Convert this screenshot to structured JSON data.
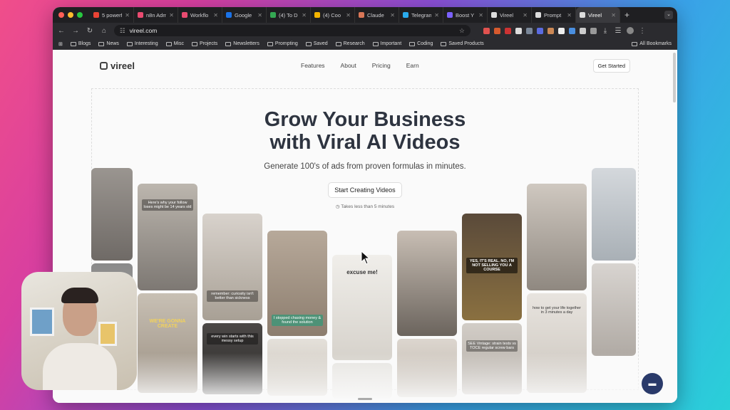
{
  "browser": {
    "tabs": [
      {
        "label": "5 powerf",
        "color": "#ea4335"
      },
      {
        "label": "n8n Adm",
        "color": "#ea4b71"
      },
      {
        "label": "Workflo",
        "color": "#ea4b71"
      },
      {
        "label": "Google",
        "color": "#1a73e8"
      },
      {
        "label": "(4) To D",
        "color": "#34a853"
      },
      {
        "label": "(4) Coo",
        "color": "#f4b400"
      },
      {
        "label": "Claude",
        "color": "#d97757"
      },
      {
        "label": "Telegram",
        "color": "#2aabee"
      },
      {
        "label": "Boost Y",
        "color": "#7b61ff"
      },
      {
        "label": "Vireel",
        "color": "#dddddd"
      },
      {
        "label": "Prompt",
        "color": "#dddddd"
      },
      {
        "label": "Vireel",
        "color": "#dddddd",
        "active": true
      }
    ],
    "url": "vireel.com",
    "bookmarks": [
      "Blogs",
      "News",
      "Interesting",
      "Misc",
      "Projects",
      "Newsletters",
      "Prompting",
      "Saved",
      "Research",
      "Important",
      "Coding",
      "Saved Products"
    ],
    "all_bookmarks": "All Bookmarks"
  },
  "site": {
    "logo": "vireel",
    "nav": [
      "Features",
      "About",
      "Pricing",
      "Earn"
    ],
    "get_started": "Get Started",
    "hero_line1": "Grow Your Business",
    "hero_line2": "with Viral AI Videos",
    "subtitle": "Generate 100's of ads from proven formulas in minutes.",
    "cta": "Start Creating Videos",
    "note": "Takes less than 5 minutes"
  },
  "cards": [
    {
      "caption": "Here's why your follow loses might be 14 years old"
    },
    {
      "caption": "WE'RE GONNA CREATE"
    },
    {
      "caption": "remember: curiosity isn't better than sickness"
    },
    {
      "caption": "every win starts with this messy setup"
    },
    {
      "caption": "I stopped chasing money & found the solution"
    },
    {
      "caption": "excuse me!"
    },
    {
      "caption": "YES, IT'S REAL. NO, I'M NOT SELLING YOU A COURSE"
    },
    {
      "caption": "how to get your life together in 3 minutes a day"
    },
    {
      "caption": "SEE Vintage: strain tests vs TOCE regular screw bars"
    }
  ]
}
